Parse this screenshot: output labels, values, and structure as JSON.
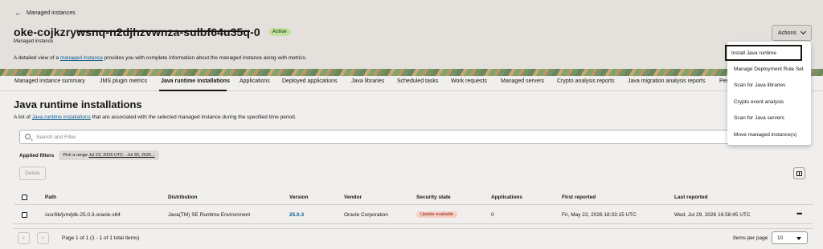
{
  "header": {
    "back_label": "Managed instances",
    "title": "oke-cojkzrywsnq-n2djhzvwnza-sulbf64u35q-0",
    "status": "Active",
    "subtitle": "Managed instance",
    "description_prefix": "A detailed view of a ",
    "description_link": "managed instance",
    "description_suffix": " provides you with complete information about the managed instance along with metrics.",
    "actions_label": "Actions"
  },
  "actions_menu": {
    "items": [
      {
        "label": "Install Java runtime"
      },
      {
        "label": "Manage Deployment Rule Set"
      },
      {
        "label": "Scan for Java libraries"
      },
      {
        "label": "Crypto event analysis"
      },
      {
        "label": "Scan for Java servers"
      },
      {
        "label": "Move managed instance(s)"
      }
    ]
  },
  "tabs": [
    {
      "label": "Managed instance summary"
    },
    {
      "label": "JMS plugin metrics"
    },
    {
      "label": "Java runtime installations"
    },
    {
      "label": "Applications"
    },
    {
      "label": "Deployed applications"
    },
    {
      "label": "Java libraries"
    },
    {
      "label": "Scheduled tasks"
    },
    {
      "label": "Work requests"
    },
    {
      "label": "Managed servers"
    },
    {
      "label": "Crypto analysis reports"
    },
    {
      "label": "Java migration analysis reports"
    },
    {
      "label": "Per"
    }
  ],
  "active_tab": "Java runtime installations",
  "page": {
    "title": "Java runtime installations",
    "desc_prefix": "A list of ",
    "desc_link": "Java runtime installations",
    "desc_suffix": " that are associated with the selected managed instance during the specified time period.",
    "search_placeholder": "Search and Filter",
    "applied_filters_label": "Applied filters",
    "filter_chip_prefix": "Pick a range ",
    "filter_chip_value": "Jul 23, 2026 UTC - Jul 30, 2026...",
    "delete_label": "Delete"
  },
  "table": {
    "columns": [
      "Path",
      "Distribution",
      "Version",
      "Vendor",
      "Security state",
      "Applications",
      "First reported",
      "Last reported"
    ],
    "rows": [
      {
        "path": "/usr/lib/jvm/jdk-25.0.3-oracle-x64",
        "distribution": "Java(TM) SE Runtime Environment",
        "version": "25.0.3",
        "vendor": "Oracle Corporation",
        "security_state": "Update available",
        "applications": "0",
        "first_reported": "Fri, May 22, 2026 18:33:15 UTC",
        "last_reported": "Wed, Jul 29, 2026 16:58:45 UTC"
      }
    ]
  },
  "pagination": {
    "info": "Page 1 of 1 (1 - 1 of 1 total items)",
    "items_per_page_label": "Items per page",
    "items_per_page": "10"
  },
  "colors": {
    "accent_link": "#0d5b8a",
    "active_badge": "#c2e0a4",
    "update_badge": "#f7cdc4"
  }
}
